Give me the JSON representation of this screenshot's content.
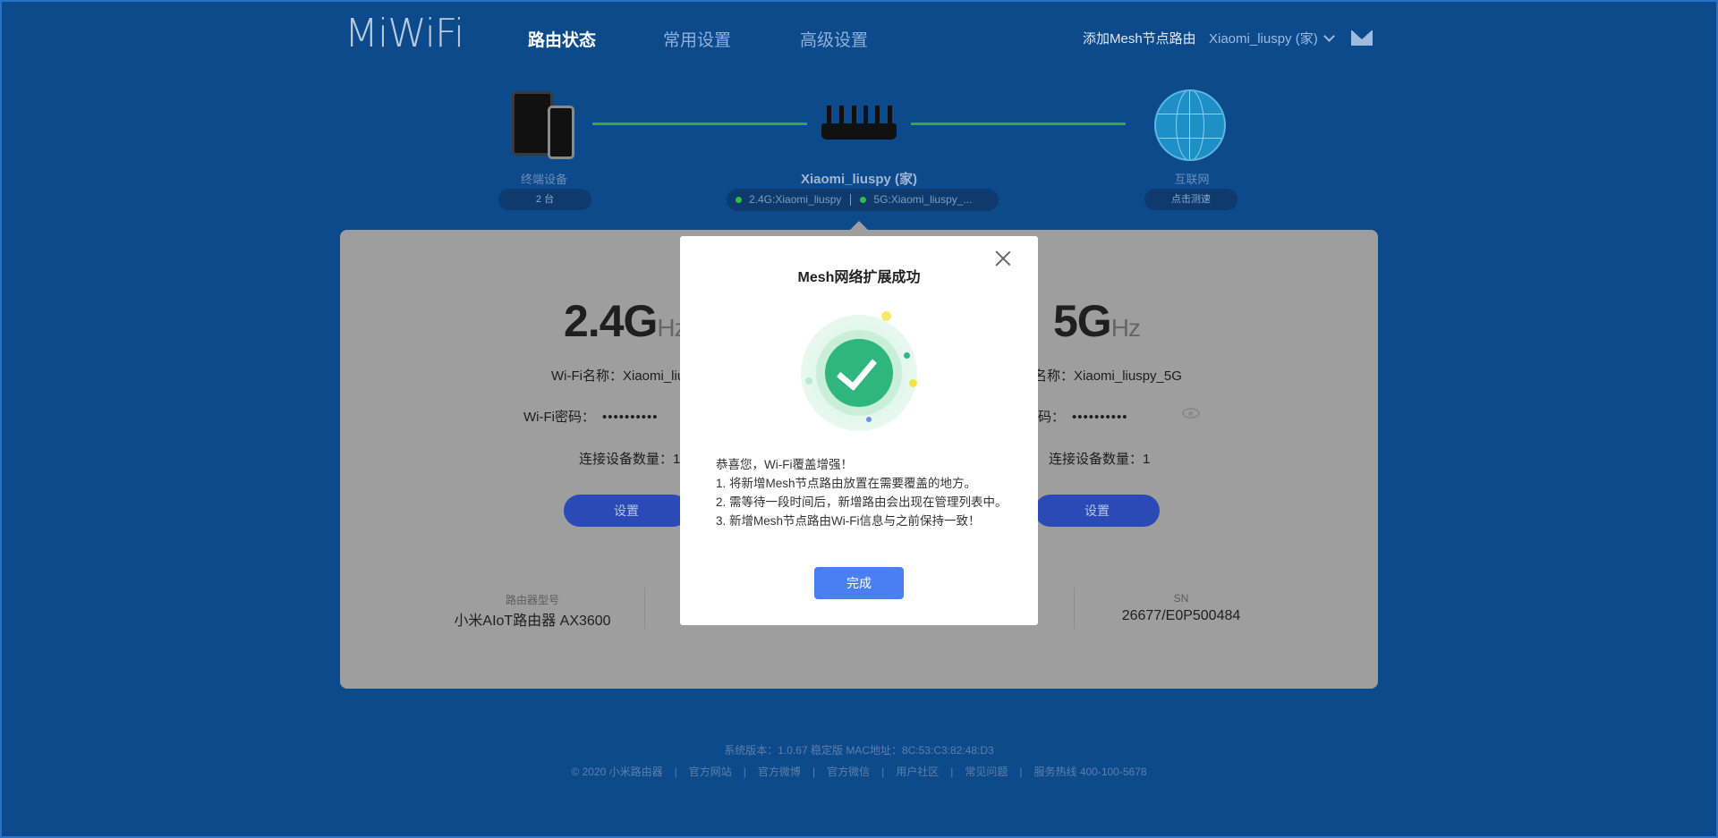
{
  "header": {
    "logo": "MiWiFi",
    "nav": [
      "路由状态",
      "常用设置",
      "高级设置"
    ],
    "add_mesh": "添加Mesh节点路由",
    "user": "Xiaomi_liuspy (家)"
  },
  "topology": {
    "devices_label": "终端设备",
    "devices_count": "2 台",
    "router_name": "Xiaomi_liuspy (家)",
    "ssid_24": "2.4G:Xiaomi_liuspy",
    "ssid_5": "5G:Xiaomi_liuspy_...",
    "internet_label": "互联网",
    "internet_action": "点击测速"
  },
  "band24": {
    "freq": "2.4G",
    "unit": "Hz",
    "name_label": "Wi-Fi名称：",
    "name": "Xiaomi_liu",
    "pw_label": "Wi-Fi密码：",
    "pw": "••••••••••",
    "devices": "连接设备数量：1",
    "set_btn": "设置"
  },
  "band5": {
    "freq": "5G",
    "unit": "Hz",
    "name_label": "名称：",
    "name": "Xiaomi_liuspy_5G",
    "pw_label": "码：",
    "pw": "••••••••••",
    "devices": "连接设备数量：1",
    "set_btn": "设置"
  },
  "info": {
    "model_label": "路由器型号",
    "model": "小米AIoT路由器 AX3600",
    "sn_label": "SN",
    "sn": "26677/E0P500484"
  },
  "footer": {
    "version": "系统版本：1.0.67 稳定版   MAC地址：8C:53:C3:82:48:D3",
    "links": [
      "© 2020 小米路由器",
      "官方网站",
      "官方微博",
      "官方微信",
      "用户社区",
      "常见问题",
      "服务热线 400-100-5678"
    ]
  },
  "modal": {
    "title": "Mesh网络扩展成功",
    "lines": [
      "恭喜您，Wi-Fi覆盖增强！",
      "1. 将新增Mesh节点路由放置在需要覆盖的地方。",
      "2. 需等待一段时间后，新增路由会出现在管理列表中。",
      "3. 新增Mesh节点路由Wi-Fi信息与之前保持一致！"
    ],
    "done": "完成"
  },
  "colors": {
    "background": "#0d4a8c",
    "accent": "#4a7ff2",
    "success": "#2fb67c",
    "link_green": "#3fa544"
  }
}
